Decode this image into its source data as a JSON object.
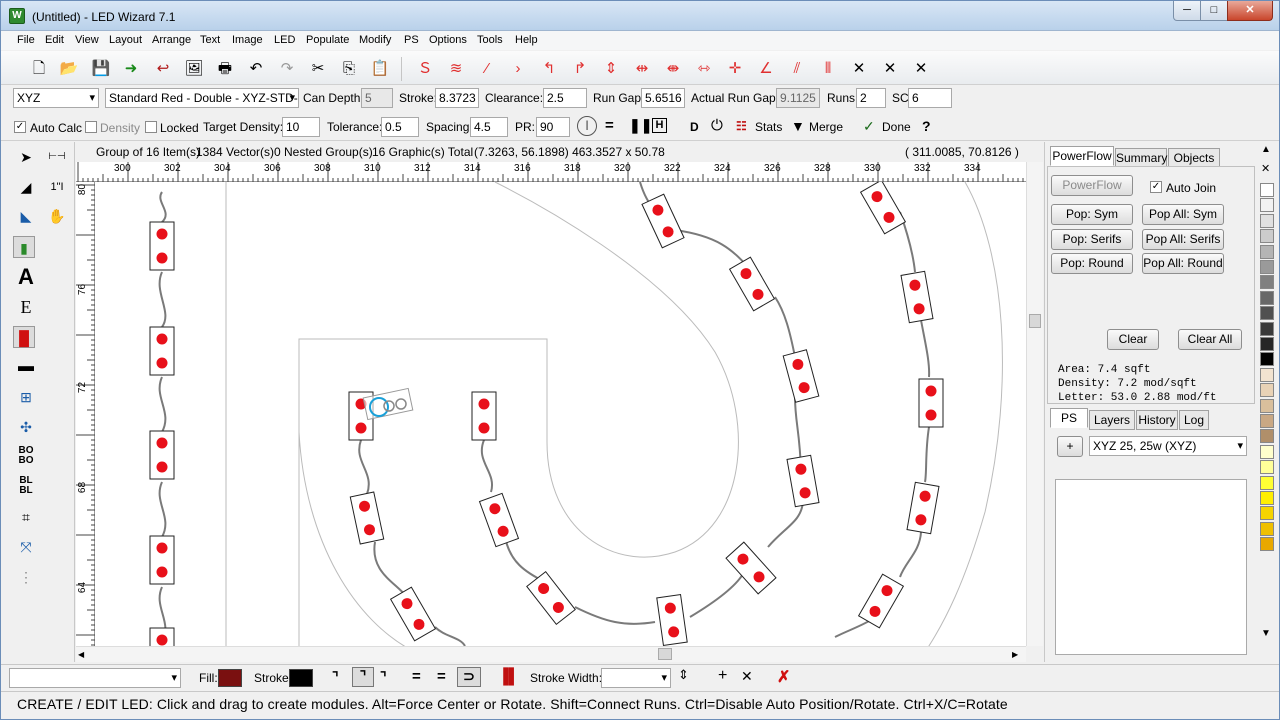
{
  "window": {
    "title": "(Untitled) - LED Wizard 7.1",
    "app_icon": "W",
    "min": "─",
    "max": "□",
    "close": "✕"
  },
  "menu": [
    "File",
    "Edit",
    "View",
    "Layout",
    "Arrange",
    "Text",
    "Image",
    "LED",
    "Populate",
    "Modify",
    "PS",
    "Options",
    "Tools",
    "Help"
  ],
  "toolbar2": {
    "font_select": "XYZ",
    "module_select": "Standard Red - Double - XYZ-STD-",
    "can_depth_label": "Can Depth:",
    "can_depth": "5",
    "stroke_label": "Stroke:",
    "stroke": "8.3723",
    "clearance_label": "Clearance:",
    "clearance": "2.5",
    "run_gap_label": "Run Gap:",
    "run_gap": "5.6516",
    "actual_run_gap_label": "Actual Run Gap:",
    "actual_run_gap": "9.1125",
    "runs_label": "Runs:",
    "runs": "2",
    "sc_label": "SC:",
    "sc": "6"
  },
  "toolbar3": {
    "auto_calc": "Auto Calc",
    "density": "Density",
    "locked": "Locked",
    "target_density_label": "Target Density:",
    "target_density": "10",
    "tolerance_label": "Tolerance:",
    "tolerance": "0.5",
    "spacing_label": "Spacing:",
    "spacing": "4.5",
    "pr_label": "PR:",
    "pr": "90",
    "d_label": "D",
    "stats": "Stats",
    "merge": "Merge",
    "done": "Done"
  },
  "status_line": {
    "group": "Group of 16 Item(s)",
    "vectors": "1384 Vector(s)",
    "nested": "0 Nested Group(s)",
    "graphics": "16 Graphic(s) Total",
    "coords": "(7.3263, 56.1898) 463.3527 x 50.78",
    "cursor": "( 311.0085,   70.8126 )"
  },
  "ruler_h": [
    "300",
    "302",
    "304",
    "306",
    "308",
    "310",
    "312",
    "314",
    "316",
    "318",
    "320",
    "322",
    "324",
    "326",
    "328",
    "330",
    "332",
    "334"
  ],
  "ruler_v": [
    "80",
    "76",
    "72",
    "68",
    "64"
  ],
  "right_panel": {
    "tabs": [
      "PowerFlow",
      "Summary",
      "Objects"
    ],
    "powerflow_btn": "PowerFlow",
    "auto_join": "Auto Join",
    "buttons": [
      "Pop: Sym",
      "Pop All: Sym",
      "Pop: Serifs",
      "Pop All: Serifs",
      "Pop: Round",
      "Pop All: Round"
    ],
    "clear": "Clear",
    "clear_all": "Clear All",
    "area": "Area: 7.4 sqft",
    "density_text": "Density: 7.2 mod/sqft",
    "letter": "Letter: 53.0 2.88 mod/ft",
    "tabs2": [
      "PS",
      "Layers",
      "History",
      "Log"
    ],
    "add_btn": "+",
    "ps_select": "XYZ 25, 25w (XYZ)"
  },
  "bottom": {
    "fill_label": "Fill:",
    "stroke_label": "Stroke:",
    "stroke_width_label": "Stroke Width:",
    "fill_color": "#7a1010",
    "stroke_color": "#000000"
  },
  "status_text": "CREATE / EDIT LED: Click and drag to create modules. Alt=Force Center or Rotate. Shift=Connect Runs. Ctrl=Disable Auto Position/Rotate. Ctrl+X/C=Rotate",
  "colors": {
    "led": "#e8101a",
    "wire": "#777777",
    "outline": "#bbbbbb"
  }
}
